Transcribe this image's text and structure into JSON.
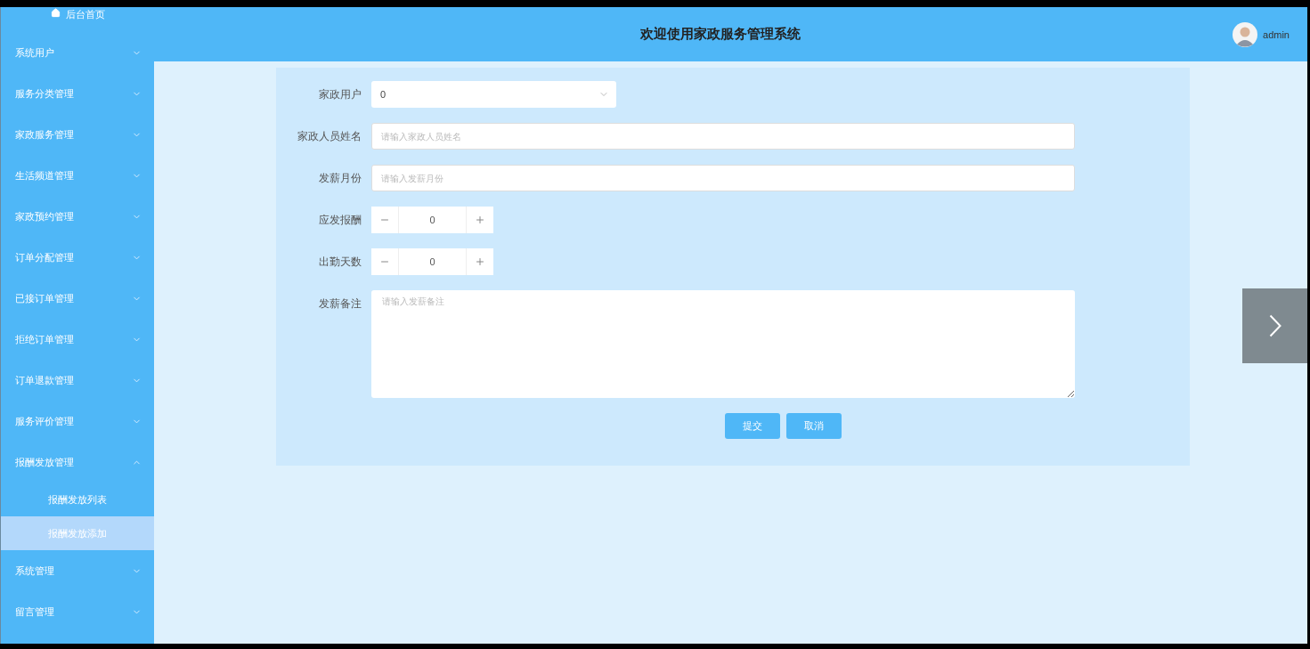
{
  "header": {
    "title": "欢迎使用家政服务管理系统",
    "user": "admin"
  },
  "sidebar": {
    "home": "后台首页",
    "items": [
      {
        "label": "系统用户",
        "expanded": false
      },
      {
        "label": "服务分类管理",
        "expanded": false
      },
      {
        "label": "家政服务管理",
        "expanded": false
      },
      {
        "label": "生活频道管理",
        "expanded": false
      },
      {
        "label": "家政预约管理",
        "expanded": false
      },
      {
        "label": "订单分配管理",
        "expanded": false
      },
      {
        "label": "已接订单管理",
        "expanded": false
      },
      {
        "label": "拒绝订单管理",
        "expanded": false
      },
      {
        "label": "订单退款管理",
        "expanded": false
      },
      {
        "label": "服务评价管理",
        "expanded": false
      },
      {
        "label": "报酬发放管理",
        "expanded": true,
        "children": [
          {
            "label": "报酬发放列表",
            "selected": false
          },
          {
            "label": "报酬发放添加",
            "selected": true
          }
        ]
      },
      {
        "label": "系统管理",
        "expanded": false
      },
      {
        "label": "留言管理",
        "expanded": false
      }
    ]
  },
  "form": {
    "fields": [
      {
        "kind": "select",
        "label": "家政用户",
        "value": "0"
      },
      {
        "kind": "text",
        "label": "家政人员姓名",
        "placeholder": "请输入家政人员姓名"
      },
      {
        "kind": "text",
        "label": "发薪月份",
        "placeholder": "请输入发薪月份"
      },
      {
        "kind": "number",
        "label": "应发报酬",
        "value": "0"
      },
      {
        "kind": "number",
        "label": "出勤天数",
        "value": "0"
      },
      {
        "kind": "textarea",
        "label": "发薪备注",
        "placeholder": "请输入发薪备注"
      }
    ],
    "buttons": [
      "提交",
      "取消"
    ]
  }
}
